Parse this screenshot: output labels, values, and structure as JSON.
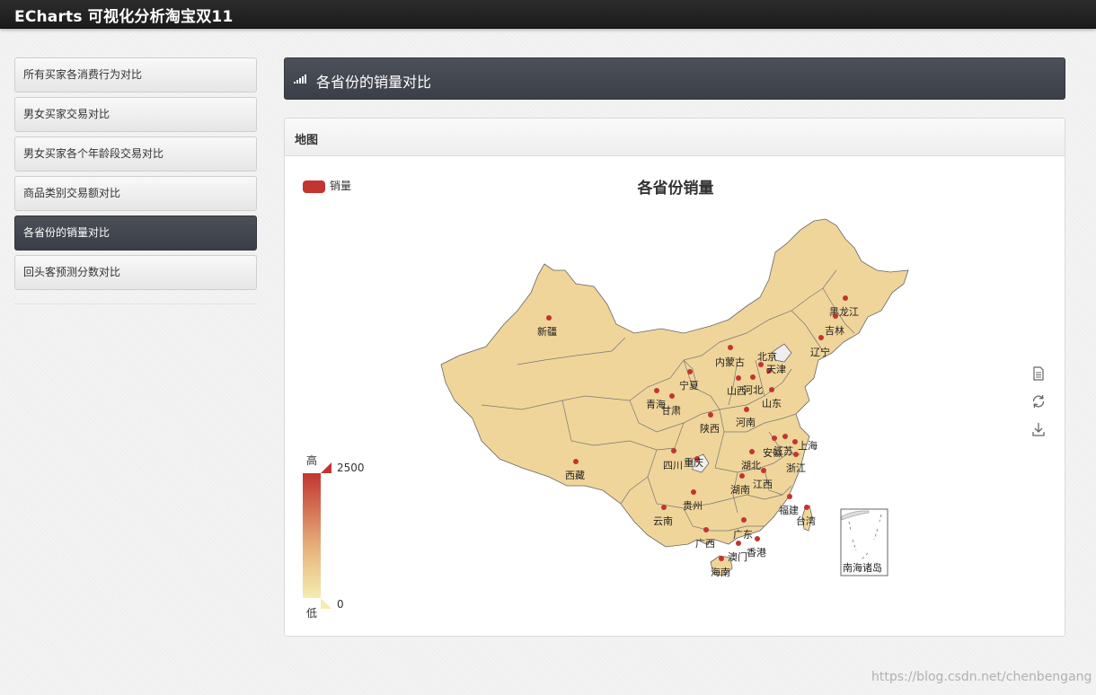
{
  "app": {
    "title": "ECharts 可视化分析淘宝双11"
  },
  "sidebar": {
    "items": [
      {
        "label": "所有买家各消费行为对比"
      },
      {
        "label": "男女买家交易对比"
      },
      {
        "label": "男女买家各个年龄段交易对比"
      },
      {
        "label": "商品类别交易额对比"
      },
      {
        "label": "各省份的销量对比",
        "active": true
      },
      {
        "label": "回头客预测分数对比"
      }
    ]
  },
  "page": {
    "title": "各省份的销量对比"
  },
  "panel": {
    "title": "地图"
  },
  "chart_data": {
    "type": "map",
    "title": "各省份销量",
    "legend": [
      "销量"
    ],
    "legend_position": "top-left",
    "series_color": "#c23531",
    "map_fill": "#f0d59a",
    "visual_map": {
      "min": 0,
      "max": 2500,
      "high_label": "高",
      "low_label": "低",
      "colors": [
        "#c23531",
        "#f5ecb0"
      ]
    },
    "toolbox": [
      "data-view-icon",
      "restore-icon",
      "save-image-icon"
    ],
    "provinces": [
      "黑龙江",
      "吉林",
      "辽宁",
      "内蒙古",
      "北京",
      "天津",
      "河北",
      "山西",
      "山东",
      "宁夏",
      "青海",
      "甘肃",
      "陕西",
      "河南",
      "新疆",
      "西藏",
      "四川",
      "重庆",
      "湖北",
      "安徽",
      "江苏",
      "上海",
      "浙江",
      "湖南",
      "江西",
      "福建",
      "台湾",
      "贵州",
      "云南",
      "广西",
      "广东",
      "澳门",
      "香港",
      "海南",
      "南海诸岛"
    ]
  },
  "watermark": "https://blog.csdn.net/chenbengang"
}
